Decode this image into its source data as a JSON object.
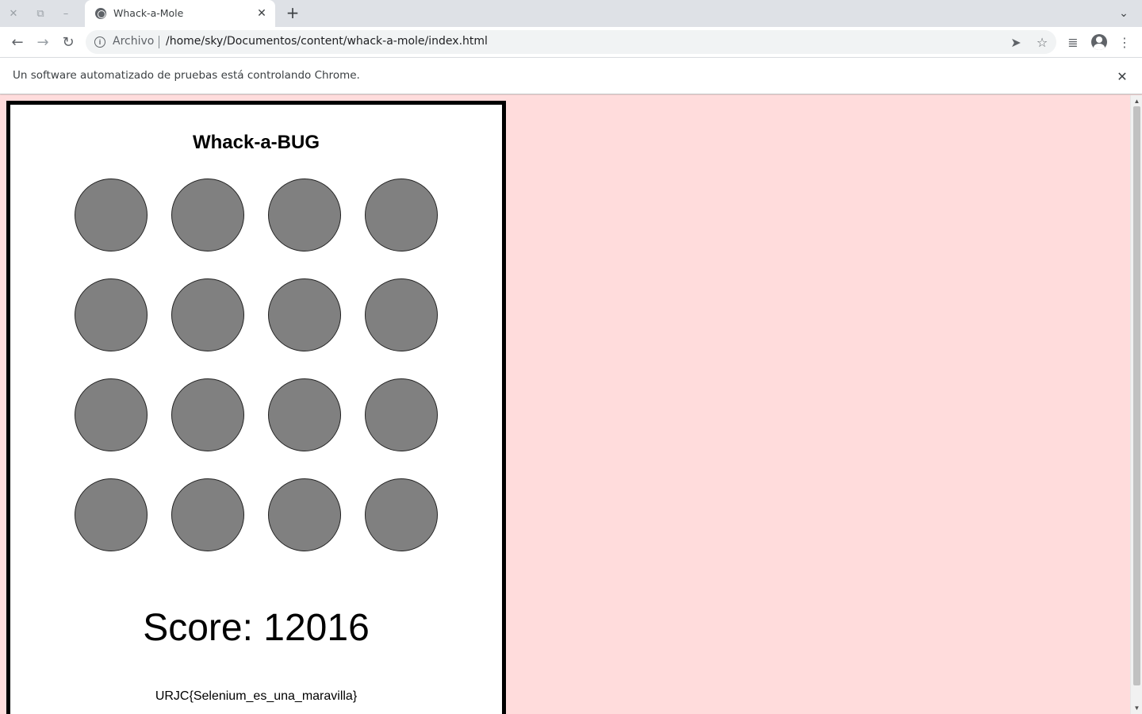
{
  "browser": {
    "tab": {
      "title": "Whack-a-Mole",
      "close_glyph": "✕"
    },
    "window_controls": [
      {
        "name": "close-window-icon",
        "glyph": "✕"
      },
      {
        "name": "restore-window-icon",
        "glyph": "⧉"
      },
      {
        "name": "minimize-window-icon",
        "glyph": "–"
      }
    ],
    "new_tab_glyph": "+",
    "tab_search_glyph": "⌄",
    "nav": {
      "back_glyph": "←",
      "forward_glyph": "→",
      "reload_glyph": "↻"
    },
    "omnibox": {
      "info_glyph": "i",
      "scheme_label": "Archivo",
      "url": "/home/sky/Documentos/content/whack-a-mole/index.html",
      "send_glyph": "➤",
      "star_glyph": "☆"
    },
    "toolbar_right": {
      "media_glyph": "≣",
      "menu_glyph": "⋮"
    },
    "infobar": {
      "message": "Un software automatizado de pruebas está controlando Chrome.",
      "close_glyph": "✕"
    },
    "scrollbar": {
      "up_glyph": "▲",
      "down_glyph": "▼"
    }
  },
  "game": {
    "title": "Whack-a-BUG",
    "holes": 16,
    "hole_color": "#808080",
    "score_label": "Score: ",
    "score": 12016,
    "flag": "URJC{Selenium_es_una_maravilla}"
  },
  "colors": {
    "page_background": "#ffdcdc",
    "board_background": "#ffffff",
    "board_border": "#000000"
  }
}
